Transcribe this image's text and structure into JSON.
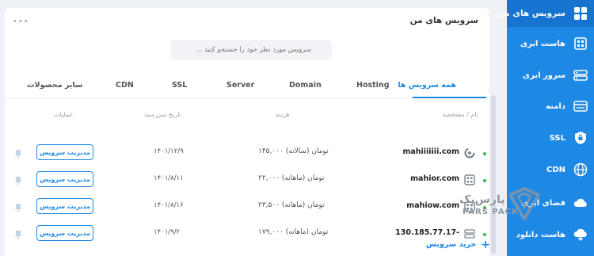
{
  "sidebar": {
    "items": [
      {
        "label": "سرویس های من",
        "icon": "grid-icon"
      },
      {
        "label": "هاست ابری",
        "icon": "cloud-host-icon"
      },
      {
        "label": "سرور ابری",
        "icon": "server-icon"
      },
      {
        "label": "دامنه",
        "icon": "domain-icon"
      },
      {
        "label": "SSL",
        "icon": "lock-icon"
      },
      {
        "label": "CDN",
        "icon": "globe-icon"
      },
      {
        "label": "فضای ابری",
        "icon": "cloud-storage-icon"
      },
      {
        "label": "هاست دانلود",
        "icon": "download-host-icon"
      }
    ]
  },
  "main": {
    "title": "سرویس های من",
    "more": "•••",
    "search_placeholder": "سرویس مورد نظر خود را جستجو کنید ...",
    "tabs": [
      "همه سرویس ها",
      "Hosting",
      "Domain",
      "Server",
      "SSL",
      "CDN",
      "سایر محصولات"
    ],
    "columns": {
      "name": "نام / مشخصه",
      "cost": "هزینه",
      "due": "تاریخ سررسید",
      "ops": "عملیات"
    },
    "rows": [
      {
        "name": "mahiiiiiii.com",
        "cost": "۱۴۵,۰۰۰ تومان (سالانه)",
        "date": "۱۴۰۱/۱۲/۹",
        "action": "مدیریت سرویس"
      },
      {
        "name": "mahior.com",
        "cost": "۲۲,۰۰۰ تومان (ماهانه)",
        "date": "۱۴۰۱/۸/۱۱",
        "action": "مدیریت سرویس"
      },
      {
        "name": "mahiow.com",
        "cost": "۲۳,۵۰۰ تومان (ماهانه)",
        "date": "۱۴۰۱/۸/۱۶",
        "action": "مدیریت سرویس"
      },
      {
        "name": "130.185.77.17-",
        "cost": "۱۷۹,۰۰۰ تومان (ماهانه)",
        "date": "۱۴۰۱/۹/۲",
        "action": "مدیریت سرویس"
      }
    ],
    "buy_label": "خرید سرویس"
  },
  "watermark": {
    "line1": "پارس‌پک",
    "line2": "PARS PACK"
  },
  "colors": {
    "accent": "#1e88e5",
    "sidebar": "#1e88e5",
    "status_active": "#3ab54a"
  }
}
